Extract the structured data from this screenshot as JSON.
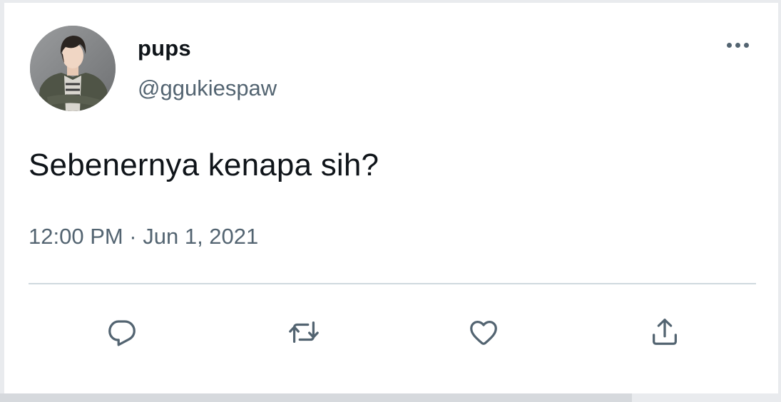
{
  "tweet": {
    "display_name": "pups",
    "handle": "@ggukiespaw",
    "text": "Sebenernya kenapa sih?",
    "timestamp": "12:00 PM · Jun 1, 2021"
  },
  "header": {
    "more_icon": "more-horizontal-icon"
  },
  "actions": [
    {
      "icon": "reply-icon"
    },
    {
      "icon": "retweet-icon"
    },
    {
      "icon": "like-icon"
    },
    {
      "icon": "share-icon"
    }
  ],
  "colors": {
    "text_primary": "#0f1419",
    "text_secondary": "#536471",
    "divider": "#cfd9de",
    "background": "#ffffff"
  }
}
